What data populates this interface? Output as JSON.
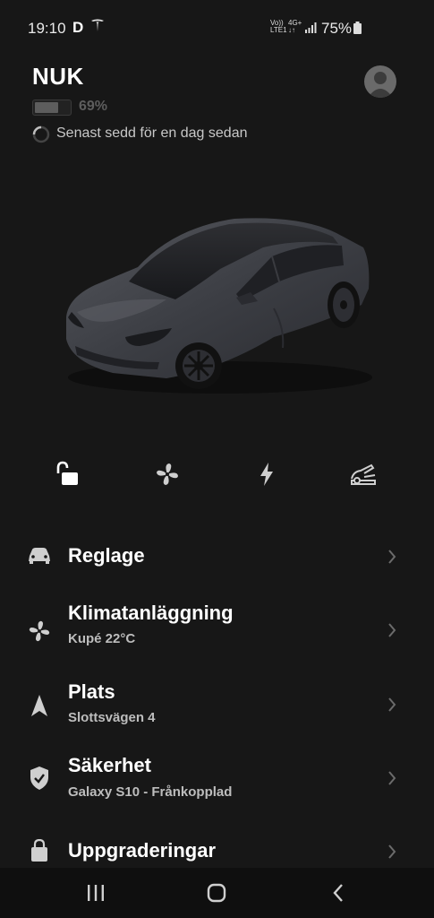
{
  "status_bar": {
    "time": "19:10",
    "network_line1": "Vo))",
    "network_line2": "LTE1",
    "data_line1": "4G+",
    "data_line2": "↓↑",
    "battery_percent": "75%"
  },
  "vehicle": {
    "name": "NUK",
    "battery_percent_text": "69%",
    "battery_level": 0.69,
    "last_seen": "Senast sedd för en dag sedan"
  },
  "quick_actions": [
    {
      "name": "unlock",
      "icon": "unlock-icon"
    },
    {
      "name": "climate",
      "icon": "fan-icon"
    },
    {
      "name": "charging",
      "icon": "bolt-icon"
    },
    {
      "name": "frunk",
      "icon": "frunk-icon"
    }
  ],
  "menu": {
    "controls": {
      "title": "Reglage",
      "icon": "car-icon"
    },
    "climate": {
      "title": "Klimatanläggning",
      "subtitle": "Kupé 22°C",
      "icon": "fan-icon"
    },
    "location": {
      "title": "Plats",
      "subtitle": "Slottsvägen 4",
      "icon": "navigation-arrow-icon"
    },
    "security": {
      "title": "Säkerhet",
      "subtitle": "Galaxy S10 - Frånkopplad",
      "icon": "shield-check-icon"
    },
    "upgrades": {
      "title": "Uppgraderingar",
      "icon": "lock-bag-icon"
    }
  },
  "colors": {
    "background": "#171717",
    "text_primary": "#ffffff",
    "text_secondary": "#bdbdbd",
    "nav_bar": "#0f0f0f"
  }
}
